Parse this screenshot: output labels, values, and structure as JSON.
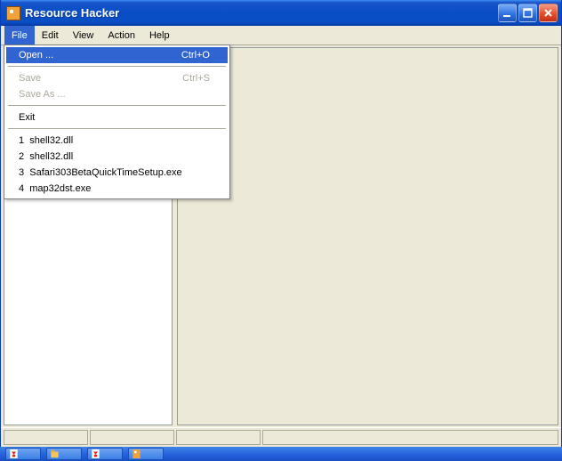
{
  "window": {
    "title": "Resource Hacker"
  },
  "menubar": {
    "items": [
      "File",
      "Edit",
      "View",
      "Action",
      "Help"
    ],
    "open_index": 0
  },
  "dropdown": {
    "open": {
      "label": "Open ...",
      "shortcut": "Ctrl+O"
    },
    "save": {
      "label": "Save",
      "shortcut": "Ctrl+S"
    },
    "save_as": {
      "label": "Save As ..."
    },
    "exit": {
      "label": "Exit"
    },
    "recent": [
      {
        "num": "1",
        "label": "shell32.dll"
      },
      {
        "num": "2",
        "label": "shell32.dll"
      },
      {
        "num": "3",
        "label": "Safari303BetaQuickTimeSetup.exe"
      },
      {
        "num": "4",
        "label": "map32dst.exe"
      }
    ]
  }
}
